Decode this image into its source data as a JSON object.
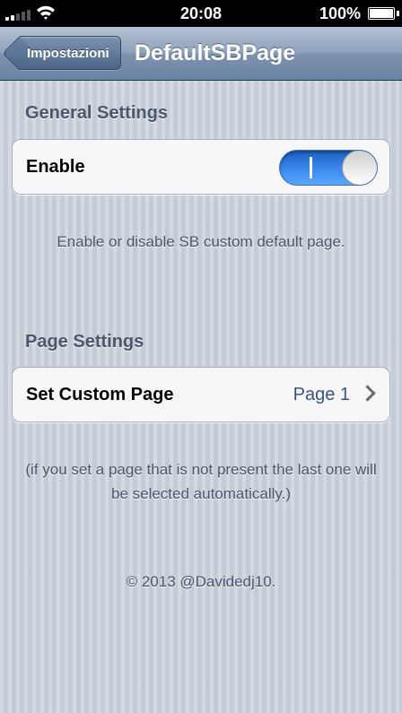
{
  "status_bar": {
    "time": "20:08",
    "battery_percent": "100%",
    "signal_bars": 2,
    "icons": [
      "signal-icon",
      "wifi-icon",
      "battery-icon"
    ]
  },
  "nav": {
    "back_label": "Impostazioni",
    "title": "DefaultSBPage"
  },
  "general_settings": {
    "header": "General Settings",
    "enable_label": "Enable",
    "enable_state": true,
    "footer": "Enable or disable SB custom default page."
  },
  "page_settings": {
    "header": "Page Settings",
    "custom_page_label": "Set Custom Page",
    "custom_page_value": "Page 1",
    "footer": "(if you set a page that is not present the last one will be selected automatically.)"
  },
  "copyright": "© 2013 @Davidedj10.",
  "colors": {
    "toggle_on": "#3e8ef2",
    "value_text": "#385487",
    "section_text": "#4c566c"
  }
}
